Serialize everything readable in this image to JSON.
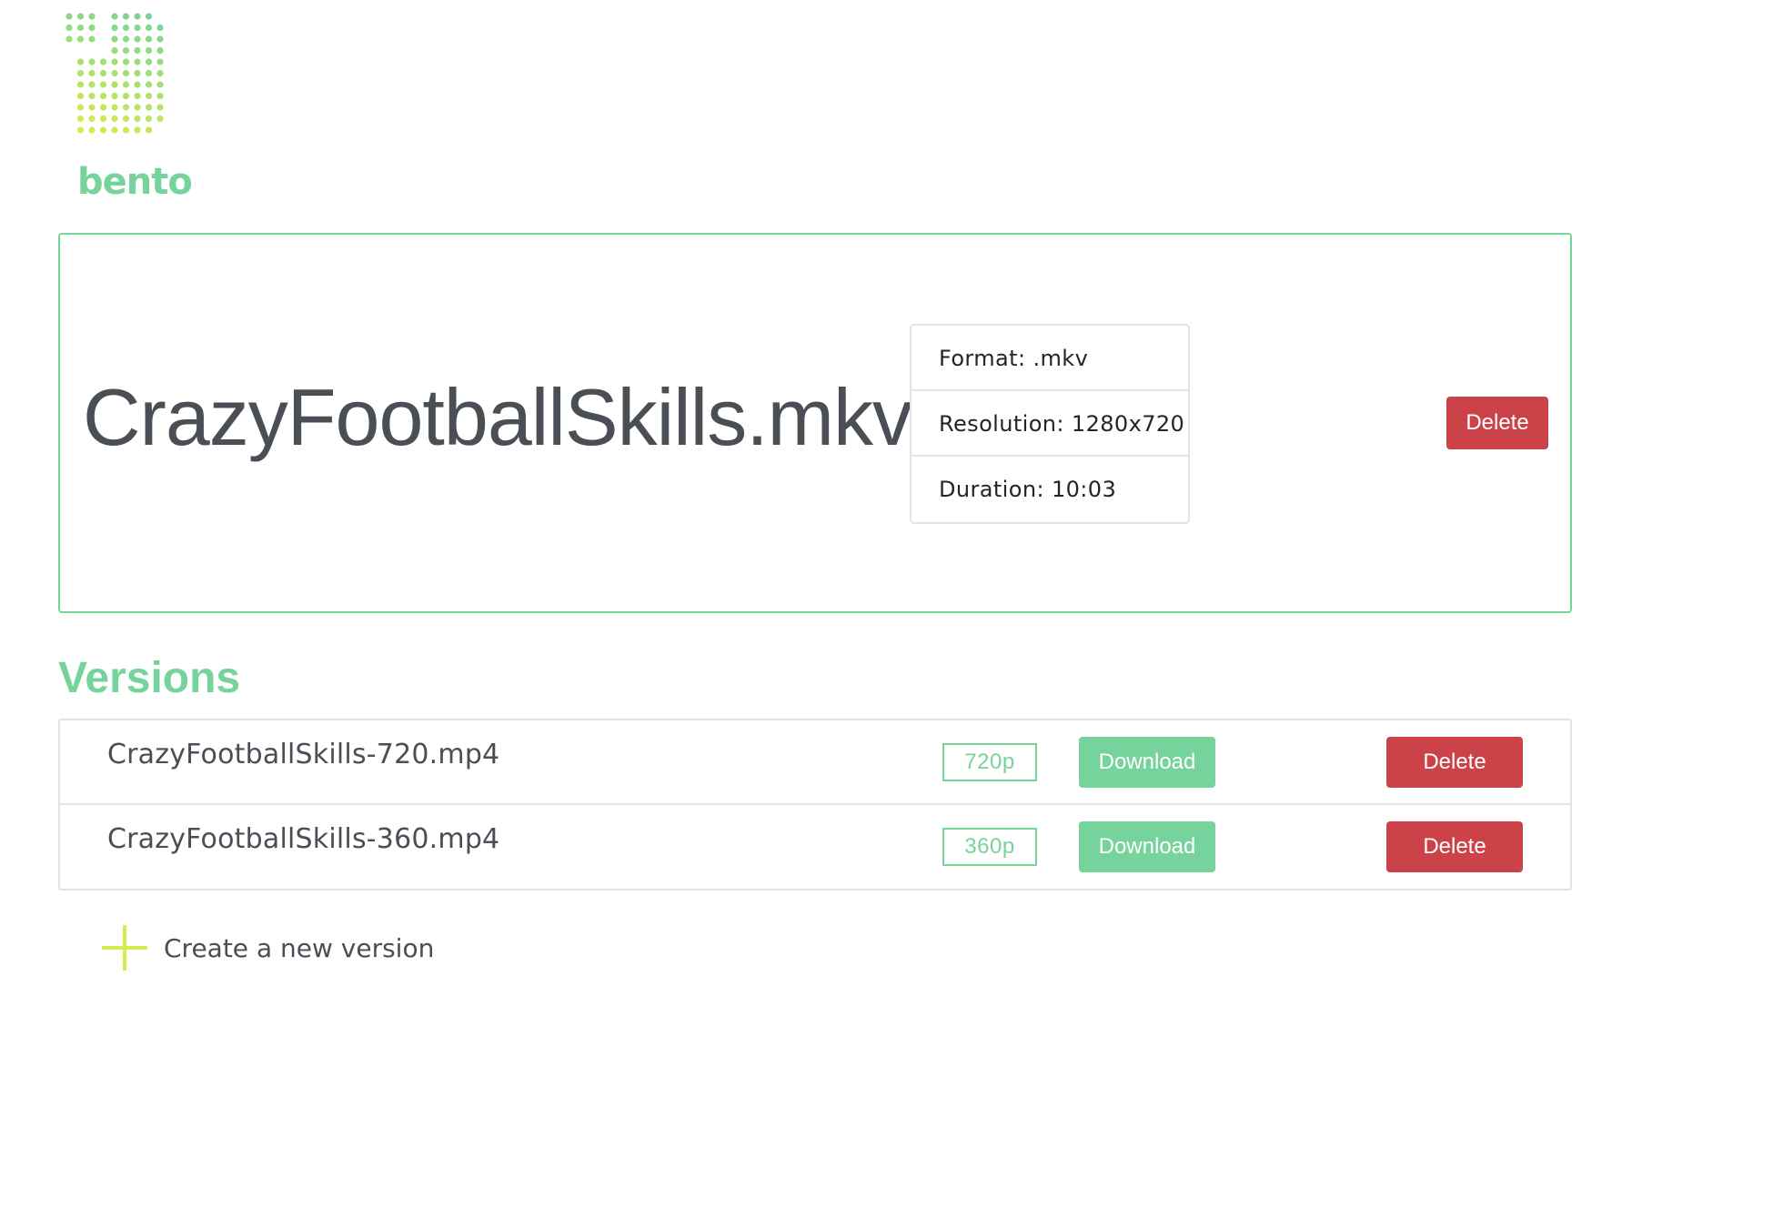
{
  "brand": {
    "name": "bento",
    "color": "#76d39b",
    "accent": "#d6eb4c"
  },
  "video": {
    "title": "CrazyFootballSkills.mkv",
    "meta": {
      "format": "Format: .mkv",
      "resolution": "Resolution: 1280x720",
      "duration": "Duration: 10:03"
    },
    "delete_label": "Delete"
  },
  "versions": {
    "heading": "Versions",
    "items": [
      {
        "name": "CrazyFootballSkills-720.mp4",
        "resolution": "720p",
        "download_label": "Download",
        "delete_label": "Delete"
      },
      {
        "name": "CrazyFootballSkills-360.mp4",
        "resolution": "360p",
        "download_label": "Download",
        "delete_label": "Delete"
      }
    ]
  },
  "create_new": {
    "label": "Create a new version",
    "icon": "plus-icon"
  },
  "colors": {
    "danger": "#cc4249",
    "success": "#76d39b",
    "border": "#e2e4e6"
  }
}
